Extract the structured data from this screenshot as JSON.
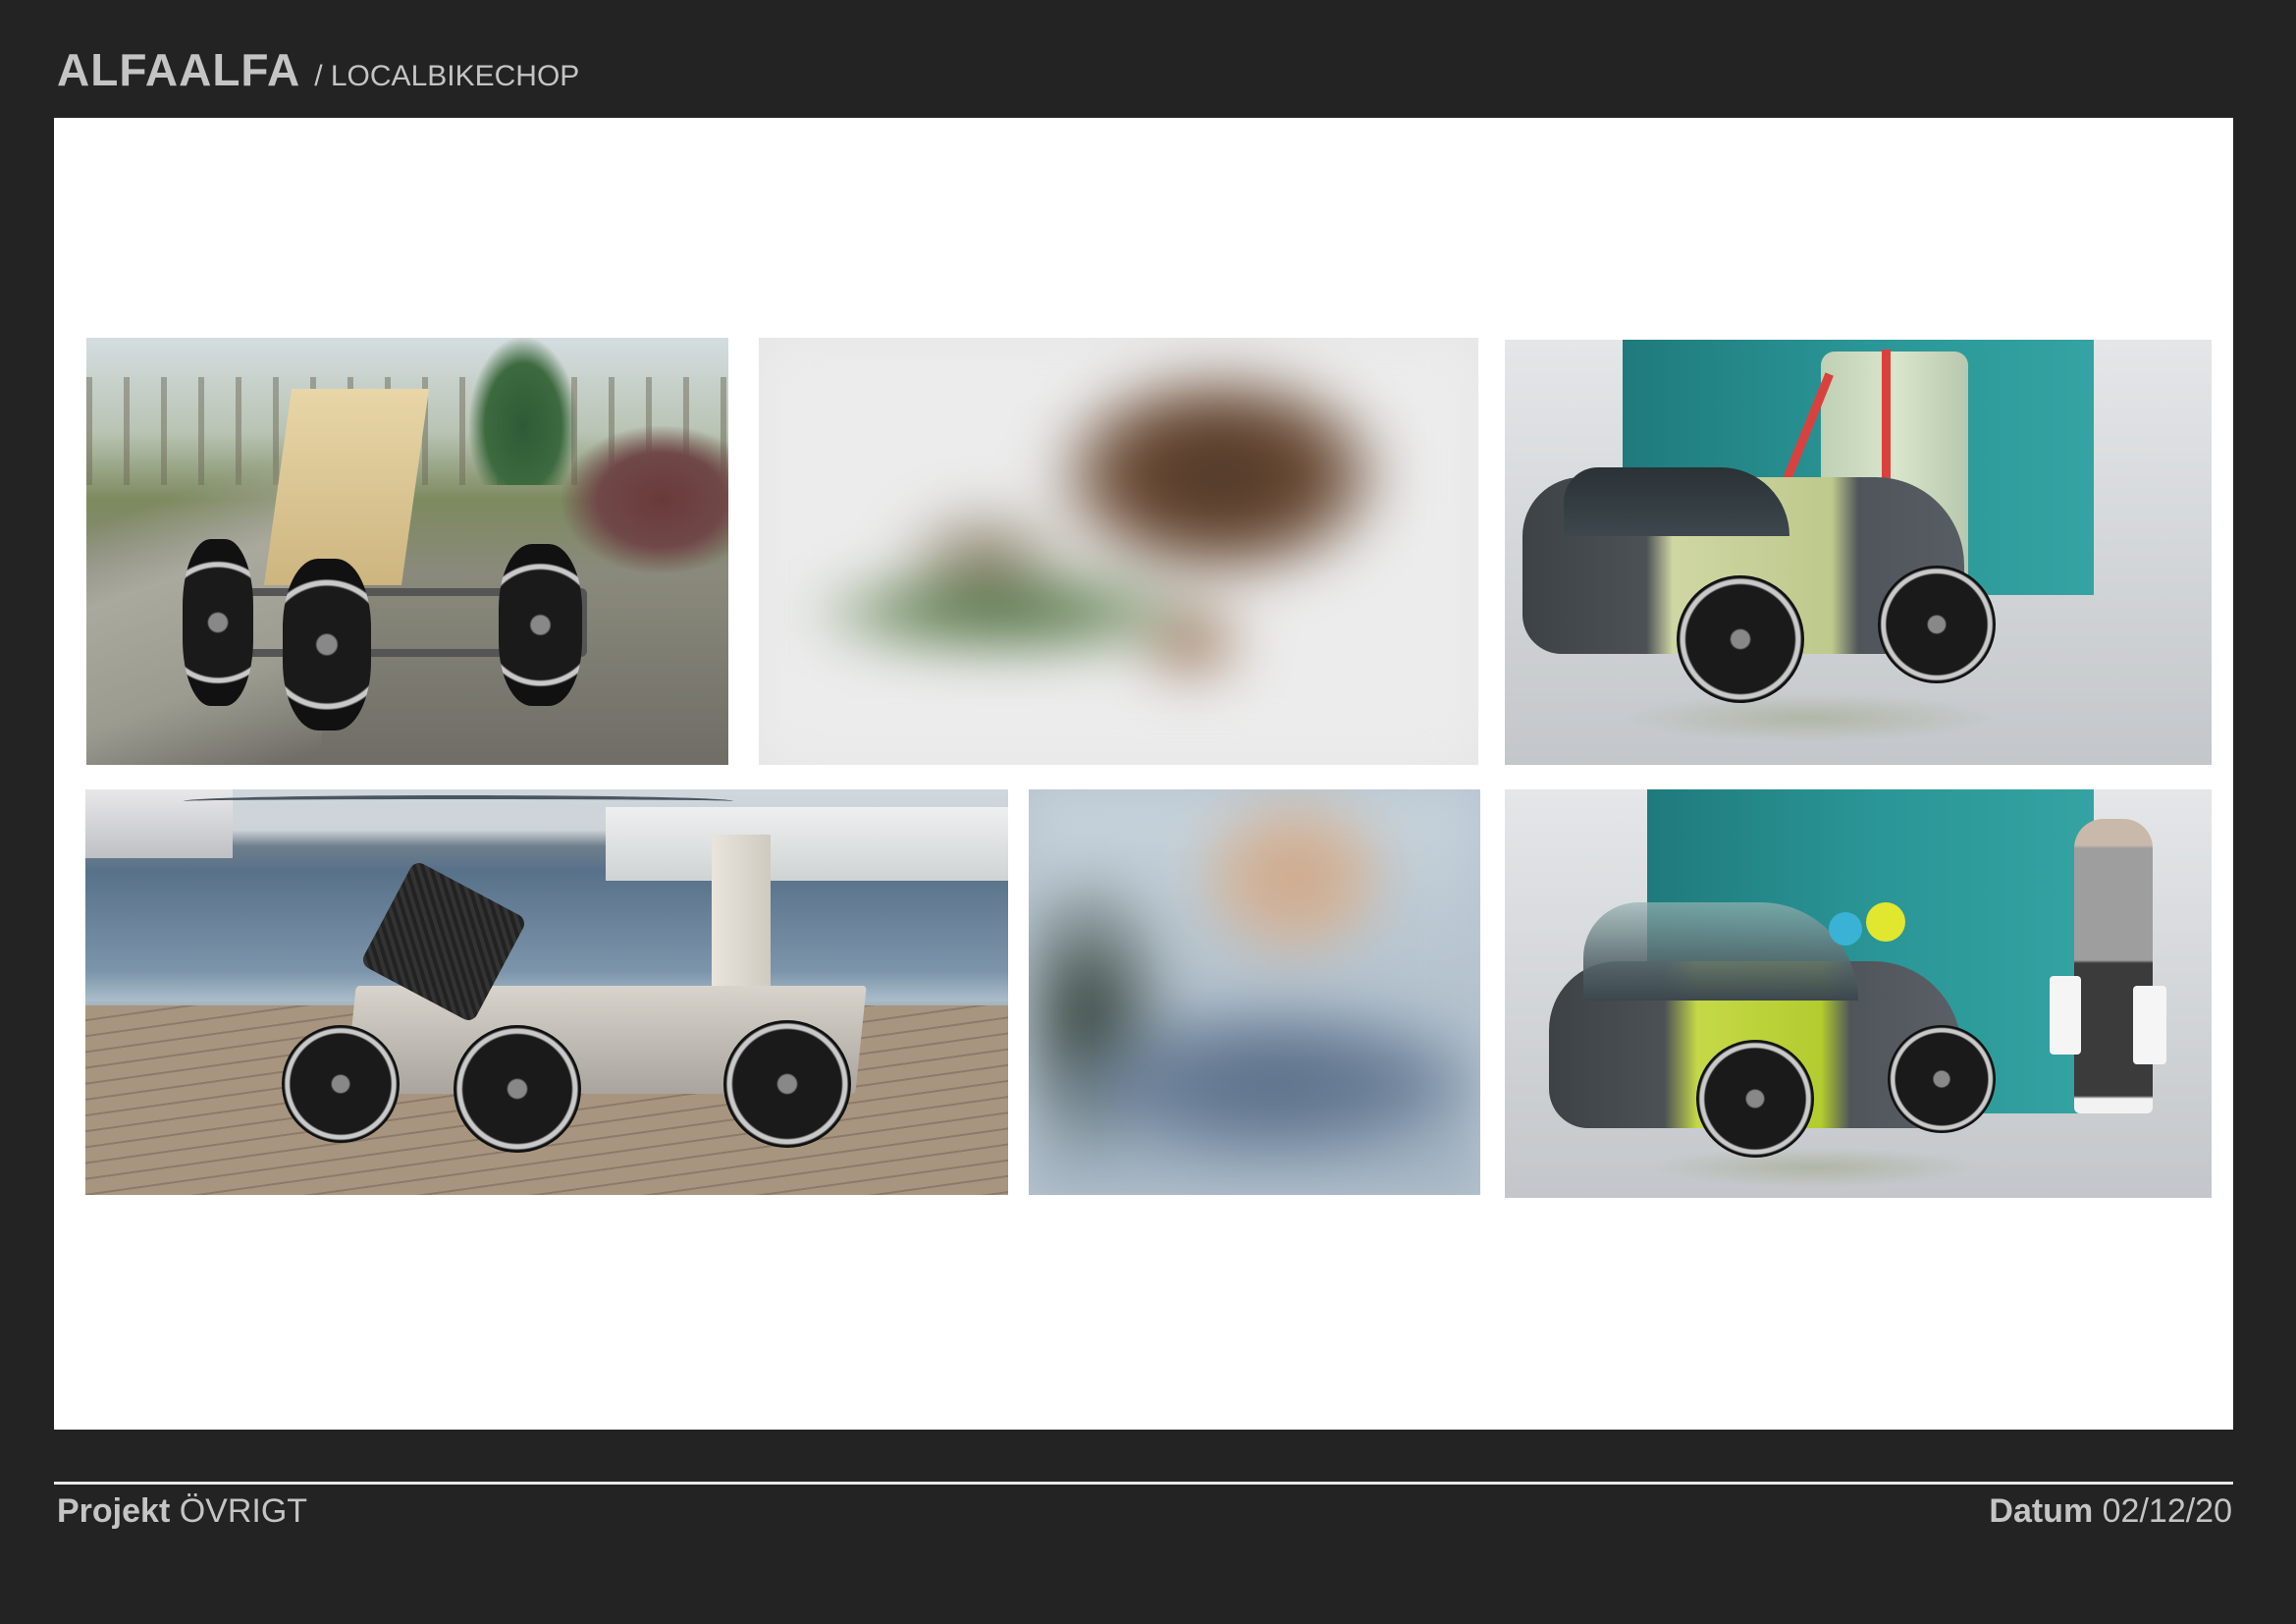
{
  "header": {
    "brand": "ALFAALFA",
    "subtitle": "/ LOCALBIKECHOP"
  },
  "footer": {
    "project_label": "Projekt",
    "project_value": "ÖVRIGT",
    "date_label": "Datum",
    "date_value": "02/12/20"
  },
  "colors": {
    "background": "#232323",
    "sheet": "#ffffff",
    "text": "#c4c4c4",
    "render_wall": "#2a9596",
    "render_green": "#cfd6a3",
    "render_yellow": "#c5d948"
  }
}
